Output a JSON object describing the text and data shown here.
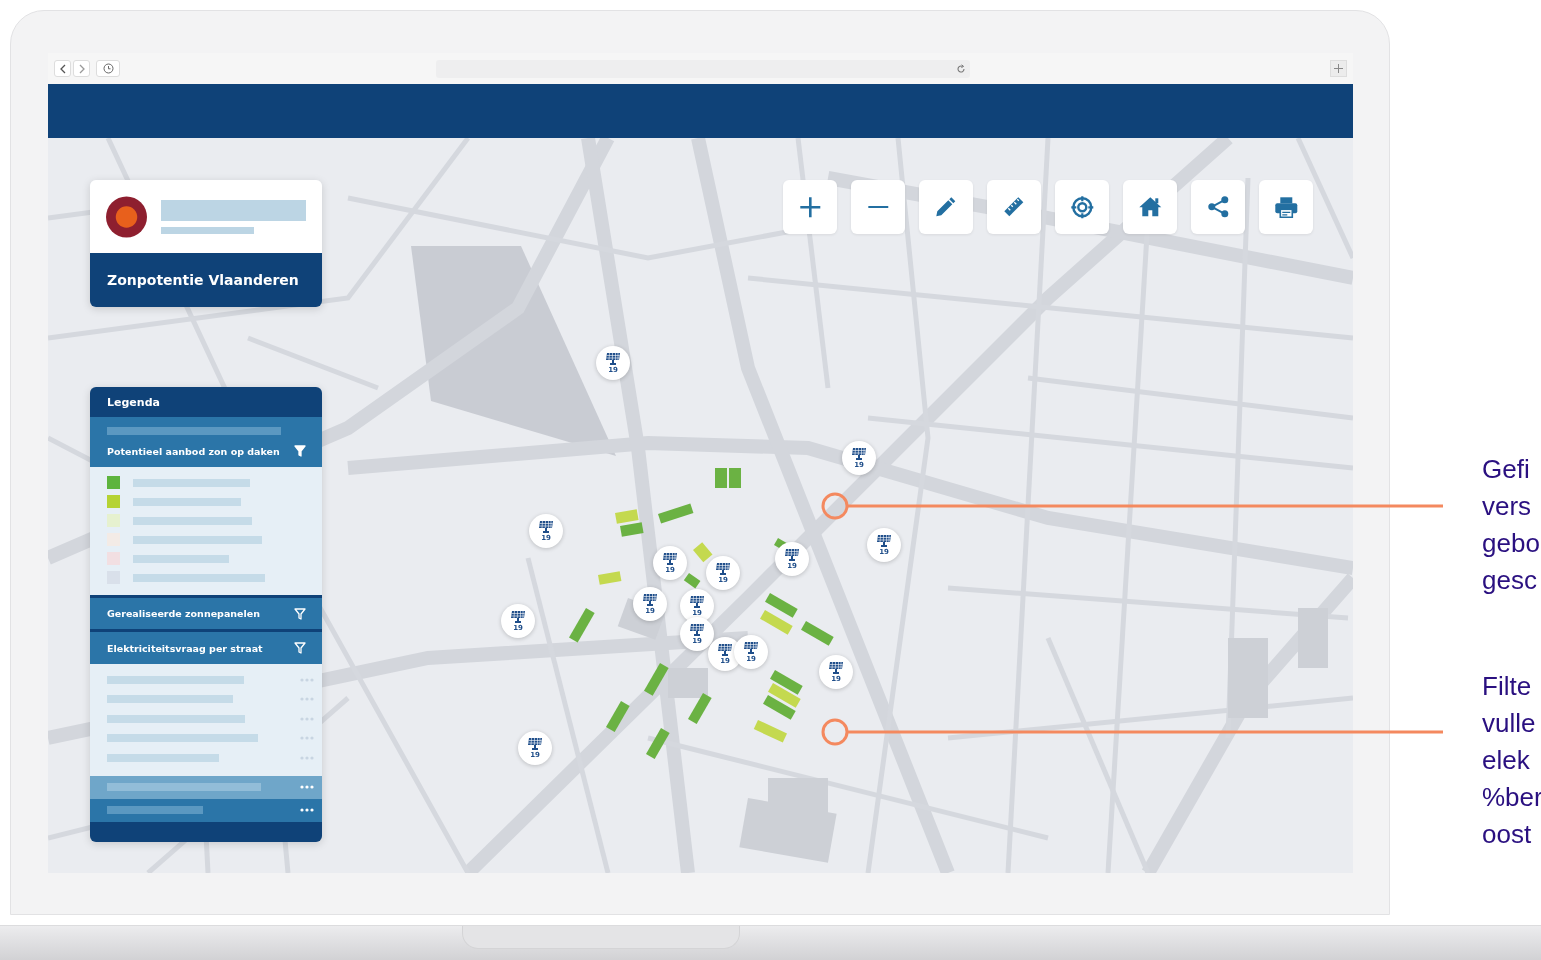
{
  "app": {
    "title": "Zonpotentie Vlaanderen"
  },
  "legend": {
    "title": "Legenda",
    "sections": [
      {
        "title": "Potentieel aanbod zon op daken",
        "filter_active": true,
        "expanded": true,
        "items": [
          {
            "kind": "swatch",
            "color": "#5db43e"
          },
          {
            "kind": "swatch",
            "color": "#b5d334"
          },
          {
            "kind": "swatch",
            "color": "#e6f1cf"
          },
          {
            "kind": "swatch",
            "color": "#f3ebe6"
          },
          {
            "kind": "swatch",
            "color": "#f2dfe2"
          },
          {
            "kind": "swatch",
            "color": "#d9e0ea"
          }
        ]
      },
      {
        "title": "Gerealiseerde zonnepanelen",
        "filter_active": false,
        "expanded": false
      },
      {
        "title": "Elektriciteitsvraag per straat",
        "filter_active": false,
        "expanded": true,
        "items": [
          {
            "kind": "row"
          },
          {
            "kind": "row"
          },
          {
            "kind": "row"
          },
          {
            "kind": "row"
          },
          {
            "kind": "row"
          },
          {
            "kind": "highlight"
          },
          {
            "kind": "active"
          }
        ]
      }
    ]
  },
  "map": {
    "markers": [
      {
        "label": "19"
      },
      {
        "label": "19"
      },
      {
        "label": "19"
      },
      {
        "label": "19"
      },
      {
        "label": "19"
      },
      {
        "label": "19"
      },
      {
        "label": "19"
      },
      {
        "label": "19"
      },
      {
        "label": "19"
      },
      {
        "label": "19"
      },
      {
        "label": "19"
      },
      {
        "label": "19"
      },
      {
        "label": "19"
      },
      {
        "label": "19"
      },
      {
        "label": "19"
      }
    ]
  },
  "callouts": [
    {
      "lines": [
        "Gefi",
        "vers",
        "gebo",
        "gesc"
      ]
    },
    {
      "lines": [
        "Filte",
        "vulle",
        "elek",
        "%ber",
        "oost"
      ]
    }
  ]
}
